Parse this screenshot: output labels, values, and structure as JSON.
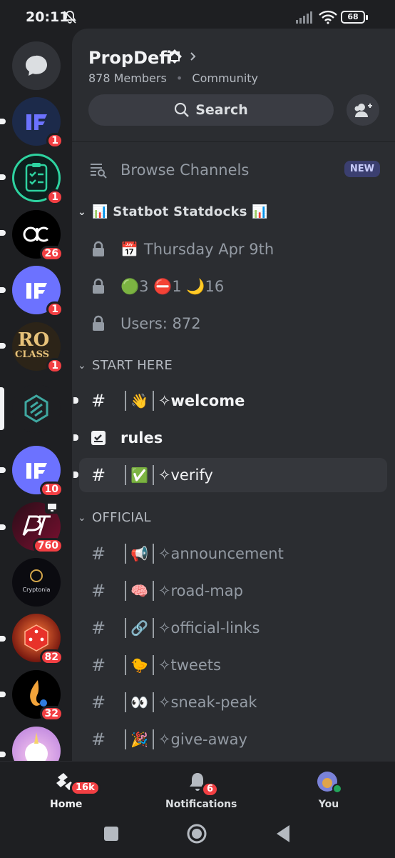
{
  "status_bar": {
    "time": "20:11",
    "battery": "68"
  },
  "server": {
    "name": "PropDefi",
    "members": "878 Members",
    "dot": "•",
    "type": "Community",
    "search_label": "Search"
  },
  "rail_badges": [
    "1",
    "1",
    "26",
    "1",
    "1",
    "10",
    "760",
    "82",
    "32"
  ],
  "rail_labels": {
    "cryptonia": "Cryptonia",
    "ro": "RO",
    "ro2": "CLASS"
  },
  "channels": {
    "browse": "Browse Channels",
    "new_badge": "NEW",
    "cat_stat": "📊 Statbot Statdocks 📊",
    "stat_date_emoji": "📅",
    "stat_date": "Thursday Apr 9th",
    "stat_status": "🟢3 ⛔1 🌙16",
    "stat_users": "Users: 872",
    "cat_start": "START HERE",
    "welcome_emoji": "👋",
    "welcome": "✧welcome",
    "rules": "rules",
    "verify_emoji": "✅",
    "verify": "✧verify",
    "cat_official": "OFFICIAL",
    "announcement_emoji": "📢",
    "announcement": "✧announcement",
    "roadmap_emoji": "🧠",
    "roadmap": "✧road-map",
    "links_emoji": "🔗",
    "links": "✧official-links",
    "tweets_emoji": "🐤",
    "tweets": "✧tweets",
    "sneak_emoji": "👀",
    "sneak": "✧sneak-peak",
    "giveaway_emoji": "🎉",
    "giveaway": "✧give-away",
    "hash": "#"
  },
  "nav": {
    "home": "Home",
    "home_badge": "16k",
    "notifications": "Notifications",
    "notif_badge": "6",
    "you": "You"
  },
  "colors": {
    "accent": "#5865f2",
    "badge": "#f23f43",
    "panel": "#2b2d31",
    "rail": "#1e1f22"
  }
}
